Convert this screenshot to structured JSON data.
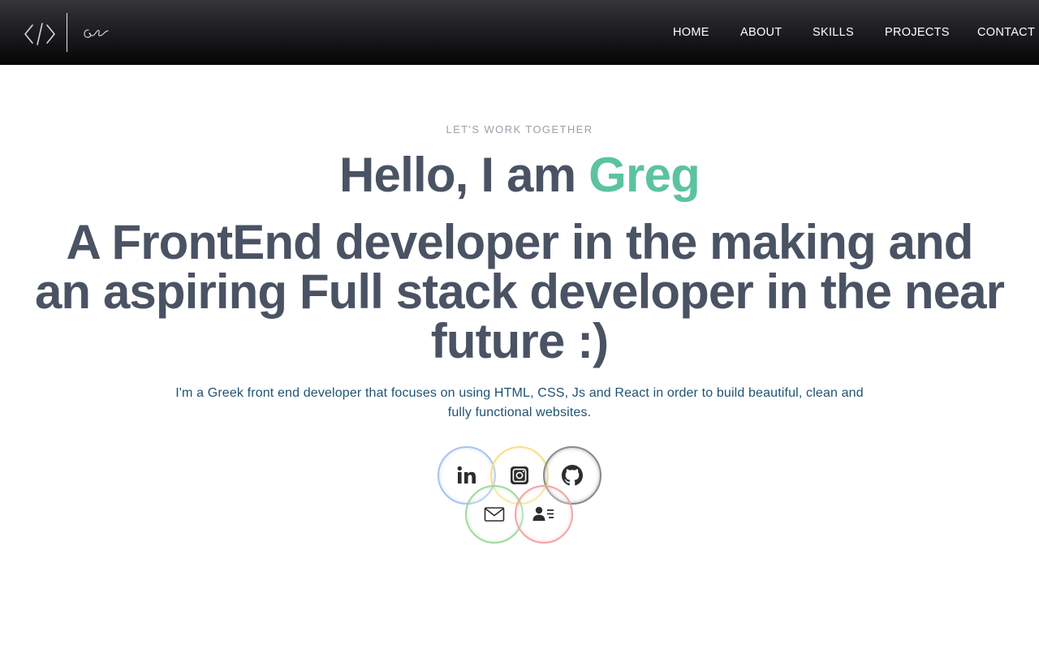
{
  "navbar": {
    "links": [
      {
        "label": "HOME"
      },
      {
        "label": "ABOUT"
      },
      {
        "label": "SKILLS"
      },
      {
        "label": "PROJECTS"
      },
      {
        "label": "CONTACT"
      }
    ],
    "logo_icon": "code-brackets-icon",
    "signature_icon": "signature-logo"
  },
  "hero": {
    "eyebrow": "LET'S WORK TOGETHER",
    "greeting": "Hello, I am",
    "name": "Greg",
    "headline": "A FrontEnd developer in the making and an aspiring Full stack developer in the near future :)",
    "intro": "I'm a Greek front end developer that focuses on using HTML, CSS, Js and React in order to build beautiful, clean and fully functional websites."
  },
  "social_links": [
    {
      "icon": "linkedin-icon",
      "ring_color": "#a8c2f2"
    },
    {
      "icon": "instagram-icon",
      "ring_color": "#f4e08c"
    },
    {
      "icon": "github-icon",
      "ring_color": "#8a8a8a"
    },
    {
      "icon": "mail-icon",
      "ring_color": "#9fd99f"
    },
    {
      "icon": "contact-card-icon",
      "ring_color": "#f1a5a5"
    }
  ],
  "colors": {
    "accent": "#5cc2a2",
    "heading": "#4a5363",
    "body_text": "#1f5273",
    "eyebrow": "#9aa1ac",
    "navbar_bg": "#1a1a1d"
  }
}
